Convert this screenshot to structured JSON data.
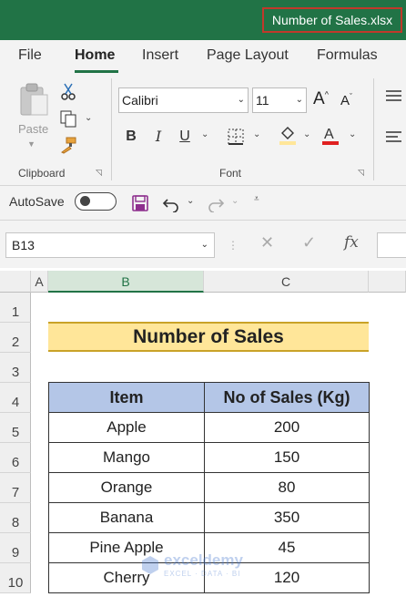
{
  "window": {
    "filename": "Number of Sales.xlsx"
  },
  "ribbon_tabs": [
    {
      "label": "File"
    },
    {
      "label": "Home"
    },
    {
      "label": "Insert"
    },
    {
      "label": "Page Layout"
    },
    {
      "label": "Formulas"
    }
  ],
  "ribbon": {
    "clipboard": {
      "paste_label": "Paste",
      "group_label": "Clipboard"
    },
    "font": {
      "name": "Calibri",
      "size": "11",
      "group_label": "Font",
      "bold": "B",
      "italic": "I",
      "underline": "U",
      "grow": "A",
      "shrink": "A"
    }
  },
  "quick_access": {
    "autosave_label": "AutoSave"
  },
  "formula_bar": {
    "name_box": "B13",
    "fx_label": "fx"
  },
  "grid": {
    "columns": [
      "A",
      "B",
      "C"
    ],
    "selected_column": "B",
    "rows": [
      "1",
      "2",
      "3",
      "4",
      "5",
      "6",
      "7",
      "8",
      "9",
      "10"
    ]
  },
  "sheet": {
    "title": "Number of Sales",
    "headers": [
      "Item",
      "No of Sales (Kg)"
    ],
    "rows": [
      [
        "Apple",
        "200"
      ],
      [
        "Mango",
        "150"
      ],
      [
        "Orange",
        "80"
      ],
      [
        "Banana",
        "350"
      ],
      [
        "Pine Apple",
        "45"
      ],
      [
        "Cherry",
        "120"
      ]
    ]
  },
  "watermark": {
    "name": "exceldemy",
    "tagline": "EXCEL · DATA · BI"
  },
  "colors": {
    "excel_green": "#217346",
    "title_fill": "#ffe699",
    "header_fill": "#b4c6e7",
    "highlight_border": "#c0392b"
  }
}
